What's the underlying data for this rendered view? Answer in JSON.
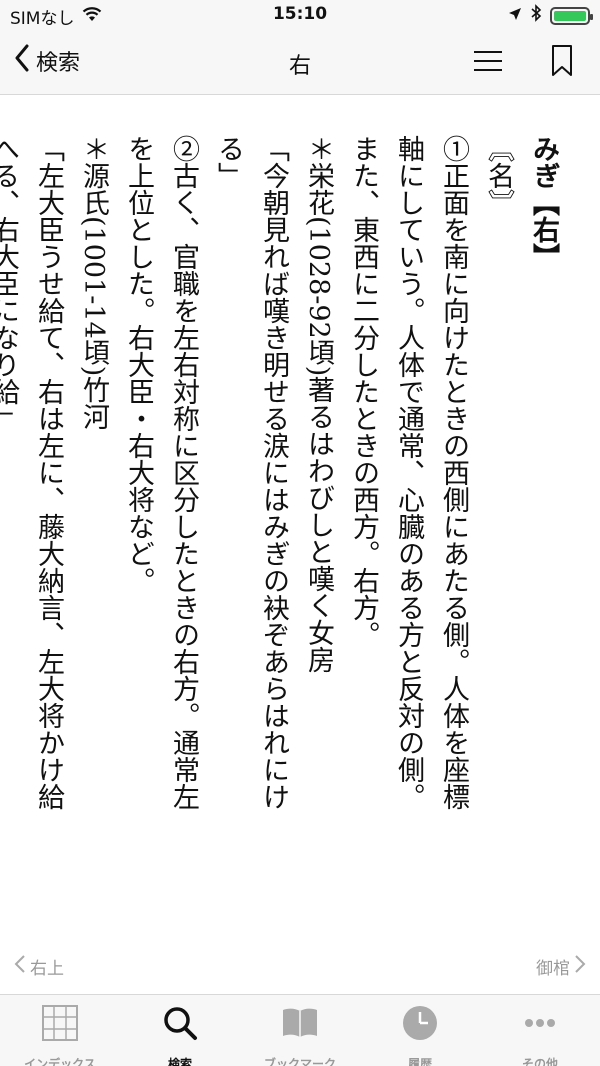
{
  "status": {
    "carrier": "SIMなし",
    "time": "15:10"
  },
  "nav": {
    "back_label": "検索",
    "title": "右"
  },
  "entry": {
    "headword": "みぎ【右】",
    "pos": "〘名〙",
    "lines": [
      "①正面を南に向けたときの西側にあたる側。人体を座標",
      "軸にしていう。人体で通常、心臓のある方と反対の側。",
      "また、東西に二分したときの西方。右方。",
      "＊栄花(1028-92頃)著るはわびしと嘆く女房",
      "「今朝見れば嘆き明せる涙にはみぎの袂ぞあらはれにけ",
      "る」",
      "②古く、官職を左右対称に区分したときの右方。通常左",
      "を上位とした。右大臣・右大将など。",
      "＊源氏(1001-14頃)竹河",
      "「左大臣うせ給て、右は左に、藤大納言、左大将かけ給",
      "へる、右大臣になり給」"
    ]
  },
  "pager": {
    "prev_label": "右上",
    "next_label": "御棺"
  },
  "tabs": [
    {
      "label": "インデックス",
      "icon": "grid-icon"
    },
    {
      "label": "検索",
      "icon": "search-icon"
    },
    {
      "label": "ブックマーク",
      "icon": "book-icon"
    },
    {
      "label": "履歴",
      "icon": "clock-icon"
    },
    {
      "label": "その他",
      "icon": "more-icon"
    }
  ],
  "colors": {
    "battery": "#34c759",
    "inactive": "#999999",
    "active": "#111111"
  }
}
